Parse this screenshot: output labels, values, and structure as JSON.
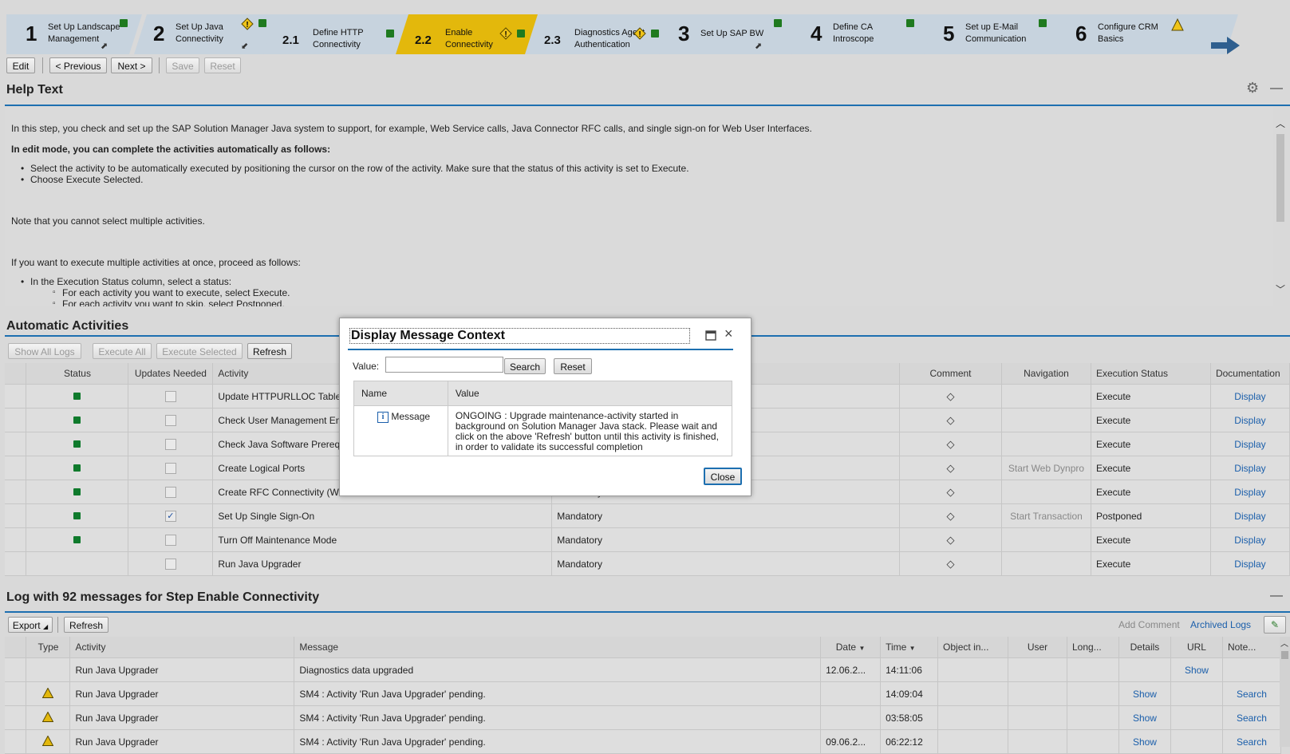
{
  "roadmap": {
    "steps": [
      {
        "num": "1",
        "label": "Set Up Landscape\nManagement"
      },
      {
        "num": "2",
        "label": "Set Up Java\nConnectivity"
      },
      {
        "num": "2.1",
        "label": "Define HTTP\nConnectivity"
      },
      {
        "num": "2.2",
        "label": "Enable\nConnectivity"
      },
      {
        "num": "2.3",
        "label": "Diagnostics Agent\nAuthentication"
      },
      {
        "num": "3",
        "label": "Set Up SAP BW"
      },
      {
        "num": "4",
        "label": "Define CA\nIntroscope"
      },
      {
        "num": "5",
        "label": "Set up E-Mail\nCommunication"
      },
      {
        "num": "6",
        "label": "Configure CRM\nBasics"
      }
    ],
    "colors": {
      "step_bg": "#c7d3de",
      "active_bg": "#e3b80c",
      "ok": "#1f7a1f",
      "warn": "#e3b80c",
      "arrow": "#2f5f8f"
    }
  },
  "toolbar": {
    "edit": "Edit",
    "previous": "< Previous",
    "next": "Next >",
    "save": "Save",
    "reset": "Reset"
  },
  "help": {
    "title": "Help Text",
    "p1": "In this step, you check and set up the SAP Solution Manager Java system to support, for example, Web Service calls, Java Connector RFC calls, and single sign-on for Web User Interfaces.",
    "p2": "In edit mode, you can complete the activities automatically as follows:",
    "b1": "Select the activity to be automatically executed by positioning the cursor on the row of the activity. Make sure that the status of this activity is set to Execute.",
    "b2": "Choose Execute Selected.",
    "p3": "Note that you cannot select multiple activities.",
    "p4": "If you want to execute multiple activities at once, proceed as follows:",
    "b3": "In the Execution Status column, select a status:",
    "s1": "For each activity you want to execute, select Execute.",
    "s2": "For each activity you want to skip, select Postponed."
  },
  "activities": {
    "title": "Automatic Activities",
    "buttons": {
      "show_all_logs": "Show All Logs",
      "execute_all": "Execute All",
      "execute_selected": "Execute Selected",
      "refresh": "Refresh"
    },
    "headers": {
      "status": "Status",
      "updates": "Updates Needed",
      "activity": "Activity",
      "comment": "Comment",
      "navigation": "Navigation",
      "exec_status": "Execution Status",
      "documentation": "Documentation"
    },
    "rows": [
      {
        "status": true,
        "checked": false,
        "activity": "Update HTTPURLLOC Table",
        "type": "",
        "navigation": "",
        "exec": "Execute",
        "doc": "Display"
      },
      {
        "status": true,
        "checked": false,
        "activity": "Check User Management Engine",
        "type": "",
        "navigation": "",
        "exec": "Execute",
        "doc": "Display"
      },
      {
        "status": true,
        "checked": false,
        "activity": "Check Java Software Prerequisites",
        "type": "",
        "navigation": "",
        "exec": "Execute",
        "doc": "Display"
      },
      {
        "status": true,
        "checked": false,
        "activity": "Create Logical Ports",
        "type": "",
        "navigation": "Start Web Dynpro",
        "exec": "Execute",
        "doc": "Display"
      },
      {
        "status": true,
        "checked": false,
        "activity": "Create RFC Connectivity (W...",
        "type": "Mandatory",
        "navigation": "",
        "exec": "Execute",
        "doc": "Display"
      },
      {
        "status": true,
        "checked": true,
        "activity": "Set Up Single Sign-On",
        "type": "Mandatory",
        "navigation": "Start Transaction",
        "exec": "Postponed",
        "doc": "Display"
      },
      {
        "status": true,
        "checked": false,
        "activity": "Turn Off Maintenance Mode",
        "type": "Mandatory",
        "navigation": "",
        "exec": "Execute",
        "doc": "Display"
      },
      {
        "status": false,
        "checked": false,
        "activity": "Run Java Upgrader",
        "type": "Mandatory",
        "navigation": "",
        "exec": "Execute",
        "doc": "Display"
      }
    ]
  },
  "log": {
    "title": "Log with 92 messages for Step Enable Connectivity",
    "buttons": {
      "export": "Export",
      "refresh": "Refresh",
      "add_comment": "Add Comment",
      "archived_logs": "Archived Logs"
    },
    "headers": {
      "type": "Type",
      "activity": "Activity",
      "message": "Message",
      "date": "Date",
      "time": "Time",
      "object": "Object in...",
      "user": "User",
      "long": "Long...",
      "details": "Details",
      "url": "URL",
      "note": "Note..."
    },
    "rows": [
      {
        "warn": false,
        "activity": "Run Java Upgrader",
        "message": "Diagnostics data upgraded",
        "date": "12.06.2...",
        "time": "14:11:06",
        "details": "",
        "url": "Show",
        "note": ""
      },
      {
        "warn": true,
        "activity": "Run Java Upgrader",
        "message": "SM4 : Activity 'Run Java Upgrader' pending.",
        "date": "",
        "time": "14:09:04",
        "details": "Show",
        "url": "",
        "note": "Search"
      },
      {
        "warn": true,
        "activity": "Run Java Upgrader",
        "message": "SM4 : Activity 'Run Java Upgrader' pending.",
        "date": "",
        "time": "03:58:05",
        "details": "Show",
        "url": "",
        "note": "Search"
      },
      {
        "warn": true,
        "activity": "Run Java Upgrader",
        "message": "SM4 : Activity 'Run Java Upgrader' pending.",
        "date": "09.06.2...",
        "time": "06:22:12",
        "details": "Show",
        "url": "",
        "note": "Search"
      }
    ]
  },
  "modal": {
    "title": "Display Message Context",
    "value_label": "Value:",
    "value_input": "",
    "search": "Search",
    "reset": "Reset",
    "col_name": "Name",
    "col_value": "Value",
    "row_name": "Message",
    "row_value": "ONGOING : Upgrade maintenance-activity started in background on Solution Manager Java stack. Please wait and click on the above 'Refresh' button until this activity is finished, in order to validate its successful completion",
    "close": "Close"
  }
}
